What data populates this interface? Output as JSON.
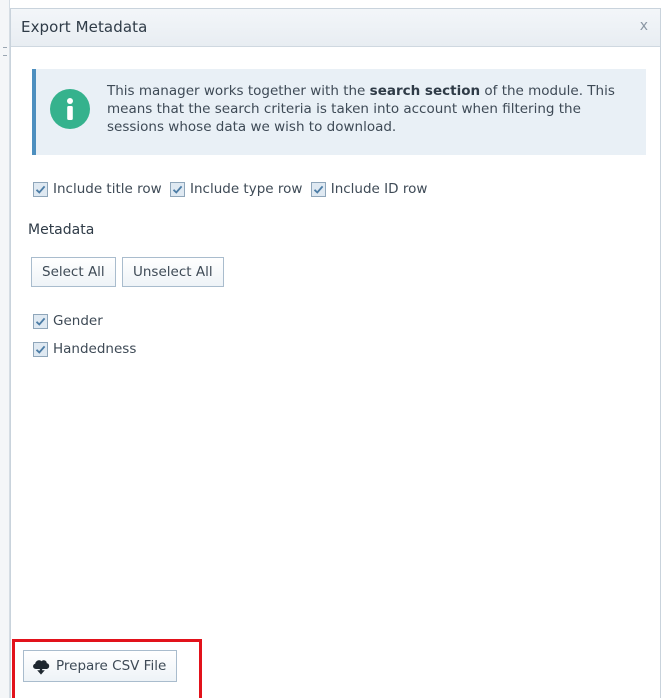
{
  "dialog": {
    "title": "Export Metadata",
    "close_label": "x"
  },
  "info": {
    "icon": "info-icon",
    "text_before": "This manager works together with the ",
    "text_bold": "search section",
    "text_after": " of the module. This means that the search criteria is taken into account when filtering the sessions whose data we wish to download."
  },
  "options": [
    {
      "label": "Include title row",
      "checked": true
    },
    {
      "label": "Include type row",
      "checked": true
    },
    {
      "label": "Include ID row",
      "checked": true
    }
  ],
  "metadata": {
    "section_title": "Metadata",
    "select_all_label": "Select All",
    "unselect_all_label": "Unselect All",
    "items": [
      {
        "label": "Gender",
        "checked": true
      },
      {
        "label": "Handedness",
        "checked": true
      }
    ]
  },
  "footer": {
    "prepare_button_label": "Prepare CSV File",
    "prepare_button_icon": "cloud-download-icon",
    "highlight_color": "#e2121b"
  },
  "colors": {
    "accent": "#4d8fbf",
    "info_icon": "#35b28d",
    "info_bg": "#e9f0f6"
  }
}
